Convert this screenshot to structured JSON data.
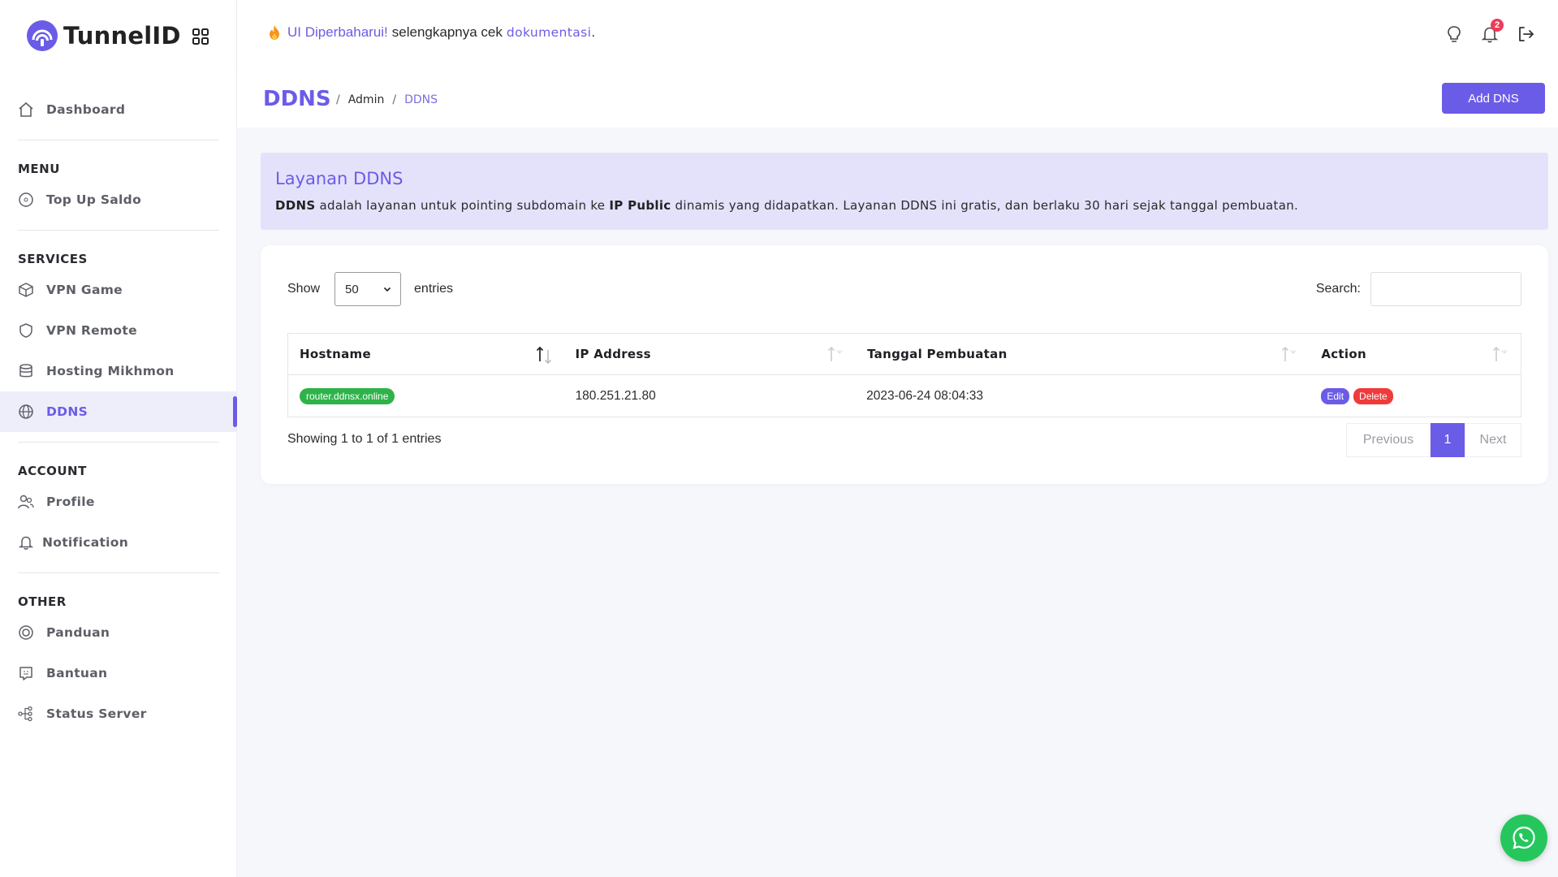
{
  "brand": {
    "name": "TunnelID",
    "accent": "#6b5ce7"
  },
  "sidebar": {
    "dashboard": "Dashboard",
    "sections": [
      {
        "heading": "MENU",
        "items": [
          {
            "label": "Top Up Saldo",
            "icon": "coin-icon"
          }
        ]
      },
      {
        "heading": "SERVICES",
        "items": [
          {
            "label": "VPN Game",
            "icon": "cube-icon"
          },
          {
            "label": "VPN Remote",
            "icon": "shield-icon"
          },
          {
            "label": "Hosting Mikhmon",
            "icon": "database-icon"
          },
          {
            "label": "DDNS",
            "icon": "globe-icon",
            "active": true
          }
        ]
      },
      {
        "heading": "ACCOUNT",
        "items": [
          {
            "label": "Profile",
            "icon": "users-icon"
          },
          {
            "label": "Notification",
            "icon": "bell-icon"
          }
        ]
      },
      {
        "heading": "OTHER",
        "items": [
          {
            "label": "Panduan",
            "icon": "target-icon"
          },
          {
            "label": "Bantuan",
            "icon": "support-icon"
          },
          {
            "label": "Status Server",
            "icon": "network-icon"
          }
        ]
      }
    ]
  },
  "topbar": {
    "announce_highlight": "UI Diperbaharui!",
    "announce_text": "selengkapnya cek",
    "announce_link": "dokumentasi",
    "announce_end": ".",
    "notification_count": "2"
  },
  "header": {
    "title": "DDNS",
    "breadcrumb": {
      "sep": "/",
      "parent": "Admin",
      "current": "DDNS"
    },
    "add_button": "Add DNS"
  },
  "alert": {
    "title": "Layanan DDNS",
    "b1": "DDNS",
    "t1": " adalah layanan untuk pointing subdomain ke ",
    "b2": "IP Public",
    "t2": " dinamis yang didapatkan. Layanan DDNS ini gratis, dan berlaku 30 hari sejak tanggal pembuatan."
  },
  "table": {
    "show_label": "Show",
    "page_size": "50",
    "entries_label": "entries",
    "search_label": "Search:",
    "search_value": "",
    "columns": [
      "Hostname",
      "IP Address",
      "Tanggal Pembuatan",
      "Action"
    ],
    "rows": [
      {
        "hostname": "router.ddnsx.online",
        "ip": "180.251.21.80",
        "created": "2023-06-24 08:04:33",
        "edit": "Edit",
        "delete": "Delete"
      }
    ],
    "info": "Showing 1 to 1 of 1 entries",
    "pager": {
      "prev": "Previous",
      "page": "1",
      "next": "Next"
    }
  }
}
